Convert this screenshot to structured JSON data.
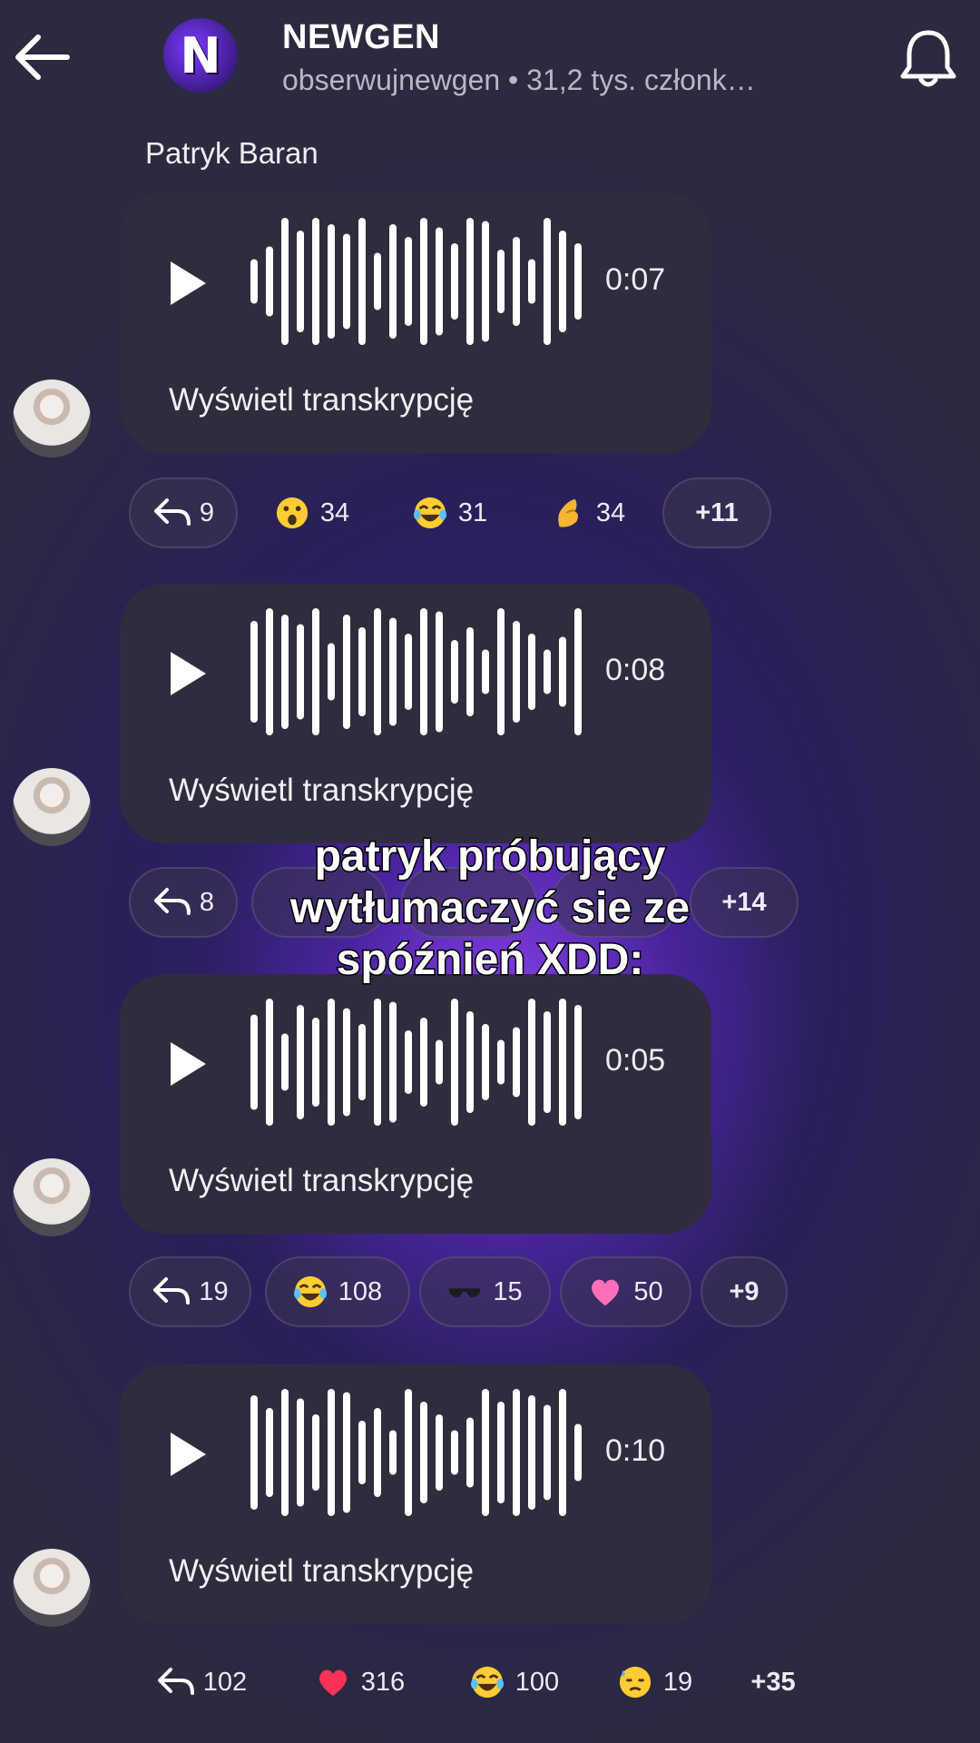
{
  "header": {
    "group_name": "NEWGEN",
    "group_sub": "obserwujnewgen • 31,2 tys. członk…",
    "logo_letter": "N"
  },
  "author": "Patryk Baran",
  "messages": [
    {
      "duration": "0:07",
      "transcript": "Wyświetl transkrypcję",
      "reactions": [
        {
          "type": "reply",
          "count": "9"
        },
        {
          "icon": "surprised-face-icon",
          "count": "34"
        },
        {
          "icon": "tears-of-joy-icon",
          "count": "31"
        },
        {
          "icon": "pinched-fingers-icon",
          "count": "34"
        },
        {
          "more": "+11"
        }
      ]
    },
    {
      "duration": "0:08",
      "transcript": "Wyświetl transkrypcję",
      "reactions": [
        {
          "type": "reply",
          "count": "8"
        },
        {
          "more": "+14"
        }
      ]
    },
    {
      "duration": "0:05",
      "transcript": "Wyświetl transkrypcję",
      "reactions": [
        {
          "type": "reply",
          "count": "19"
        },
        {
          "icon": "tears-of-joy-icon",
          "count": "108"
        },
        {
          "icon": "sunglasses-icon",
          "count": "15"
        },
        {
          "icon": "pink-heart-icon",
          "count": "50"
        },
        {
          "more": "+9"
        }
      ]
    },
    {
      "duration": "0:10",
      "transcript": "Wyświetl transkrypcję",
      "reactions": [
        {
          "type": "reply",
          "count": "102"
        },
        {
          "icon": "red-heart-icon",
          "count": "316"
        },
        {
          "icon": "tears-of-joy-icon",
          "count": "100"
        },
        {
          "icon": "downcast-sweat-face-icon",
          "count": "19"
        },
        {
          "more": "+35"
        }
      ]
    }
  ],
  "overlay_caption": "patryk próbujący wytłumaczyć sie ze spóźnień XDD:",
  "colors": {
    "bubble": "#302c3d",
    "glow": "#8f46ff",
    "background": "#2b2a3f"
  }
}
